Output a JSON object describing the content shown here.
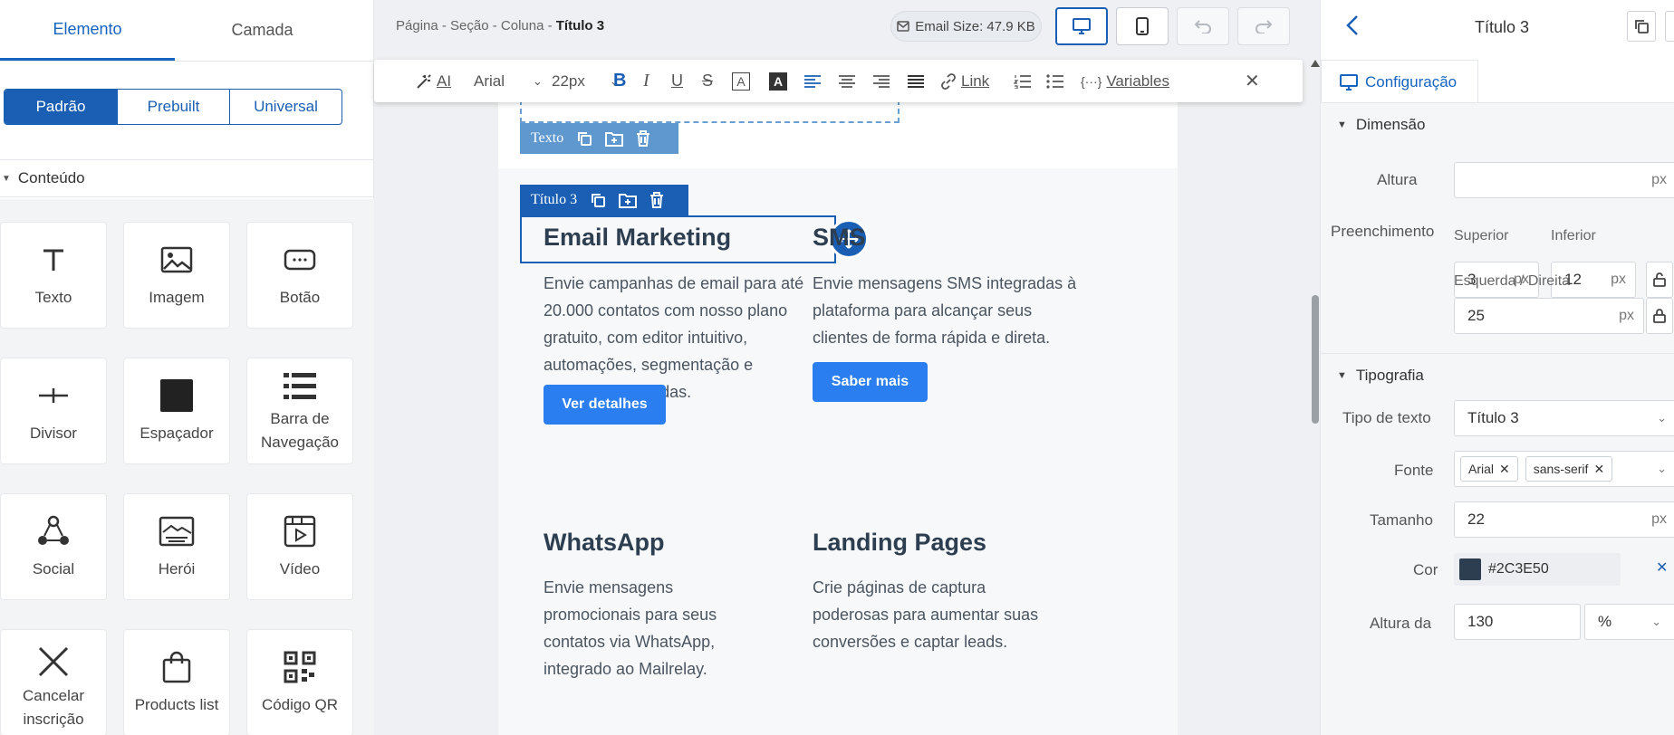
{
  "left_panel": {
    "tabs": [
      "Elemento",
      "Camada"
    ],
    "segments": [
      "Padrão",
      "Prebuilt",
      "Universal"
    ],
    "section_title": "Conteúdo",
    "tiles": [
      {
        "label": "Texto",
        "icon": "text-icon"
      },
      {
        "label": "Imagem",
        "icon": "image-icon"
      },
      {
        "label": "Botão",
        "icon": "button-icon"
      },
      {
        "label": "Divisor",
        "icon": "divider-icon"
      },
      {
        "label": "Espaçador",
        "icon": "spacer-icon"
      },
      {
        "label": "Barra de Navegação",
        "icon": "navbar-icon"
      },
      {
        "label": "Social",
        "icon": "social-icon"
      },
      {
        "label": "Herói",
        "icon": "hero-icon"
      },
      {
        "label": "Vídeo",
        "icon": "video-icon"
      },
      {
        "label": "Cancelar inscrição",
        "icon": "close-icon"
      },
      {
        "label": "Products list",
        "icon": "shopping-bag-icon"
      },
      {
        "label": "Código QR",
        "icon": "qr-code-icon"
      }
    ]
  },
  "canvas": {
    "breadcrumb": {
      "path": "Página - Seção - Coluna - ",
      "current": "Título 3"
    },
    "email_size": "Email Size: 47.9 KB",
    "toolbar": {
      "ai": "AI",
      "font": "Arial",
      "size": "22px",
      "link": "Link",
      "variables": "Variables"
    },
    "text_tag": "Texto",
    "heading_tag": "Título 3",
    "blocks": [
      {
        "title": "Email Marketing",
        "body": "Envie campanhas de email para até 20.000 contatos com nosso plano gratuito, com editor intuitivo, automações, segmentação e análises avançadas.",
        "button": "Ver detalhes"
      },
      {
        "title": "SMS",
        "body": "Envie mensagens SMS integradas à plataforma para alcançar seus clientes de forma rápida e direta.",
        "button": "Saber mais"
      },
      {
        "title": "WhatsApp",
        "body": "Envie mensagens promocionais para seus contatos via WhatsApp, integrado ao Mailrelay."
      },
      {
        "title": "Landing Pages",
        "body": "Crie páginas de captura poderosas para aumentar suas conversões e captar leads."
      }
    ]
  },
  "right_panel": {
    "title": "Título 3",
    "tab": "Configuração",
    "dimension": {
      "group": "Dimensão",
      "height_label": "Altura",
      "height_value": "",
      "unit": "px",
      "padding_label": "Preenchimento",
      "top_label": "Superior",
      "top_value": "3",
      "bottom_label": "Inferior",
      "bottom_value": "12",
      "lr_label": "Esquerda / Direita",
      "lr_value": "25"
    },
    "typography": {
      "group": "Tipografia",
      "type_label": "Tipo de texto",
      "type_value": "Título 3",
      "font_label": "Fonte",
      "font_chips": [
        "Arial",
        "sans-serif"
      ],
      "size_label": "Tamanho",
      "size_value": "22",
      "color_label": "Cor",
      "color_value": "#2C3E50",
      "line_height_label": "Altura da",
      "line_height_value": "130",
      "line_height_unit": "%"
    }
  },
  "colors": {
    "accent": "#1a5fb4",
    "button": "#2a7ef0",
    "heading": "#2C3E50"
  }
}
